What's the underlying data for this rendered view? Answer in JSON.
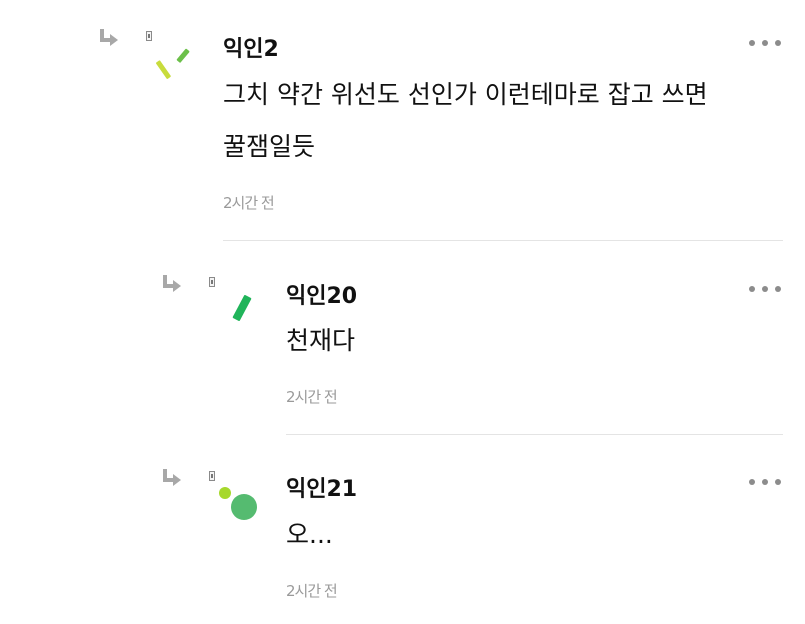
{
  "comments": [
    {
      "author": "익인2",
      "lines": [
        "그치 약간 위선도 선인가 이런테마로 잡고 쓰면",
        "꿀잼일듯"
      ],
      "time": "2시간 전"
    },
    {
      "author": "익인20",
      "lines": [
        "천재다"
      ],
      "time": "2시간 전"
    },
    {
      "author": "익인21",
      "lines": [
        "오..."
      ],
      "time": "2시간 전"
    }
  ],
  "icons": {
    "reply": "reply-arrow-icon",
    "badge": "member-badge-icon",
    "more": "more-options-icon"
  },
  "colors": {
    "text": "#111111",
    "meta": "#9a9a9a",
    "divider": "#e4e4e4",
    "avatar_lime": "#c8dc3c",
    "avatar_green": "#6cc04a",
    "avatar_emerald": "#20b45a",
    "avatar_circle": "#55bb70"
  }
}
